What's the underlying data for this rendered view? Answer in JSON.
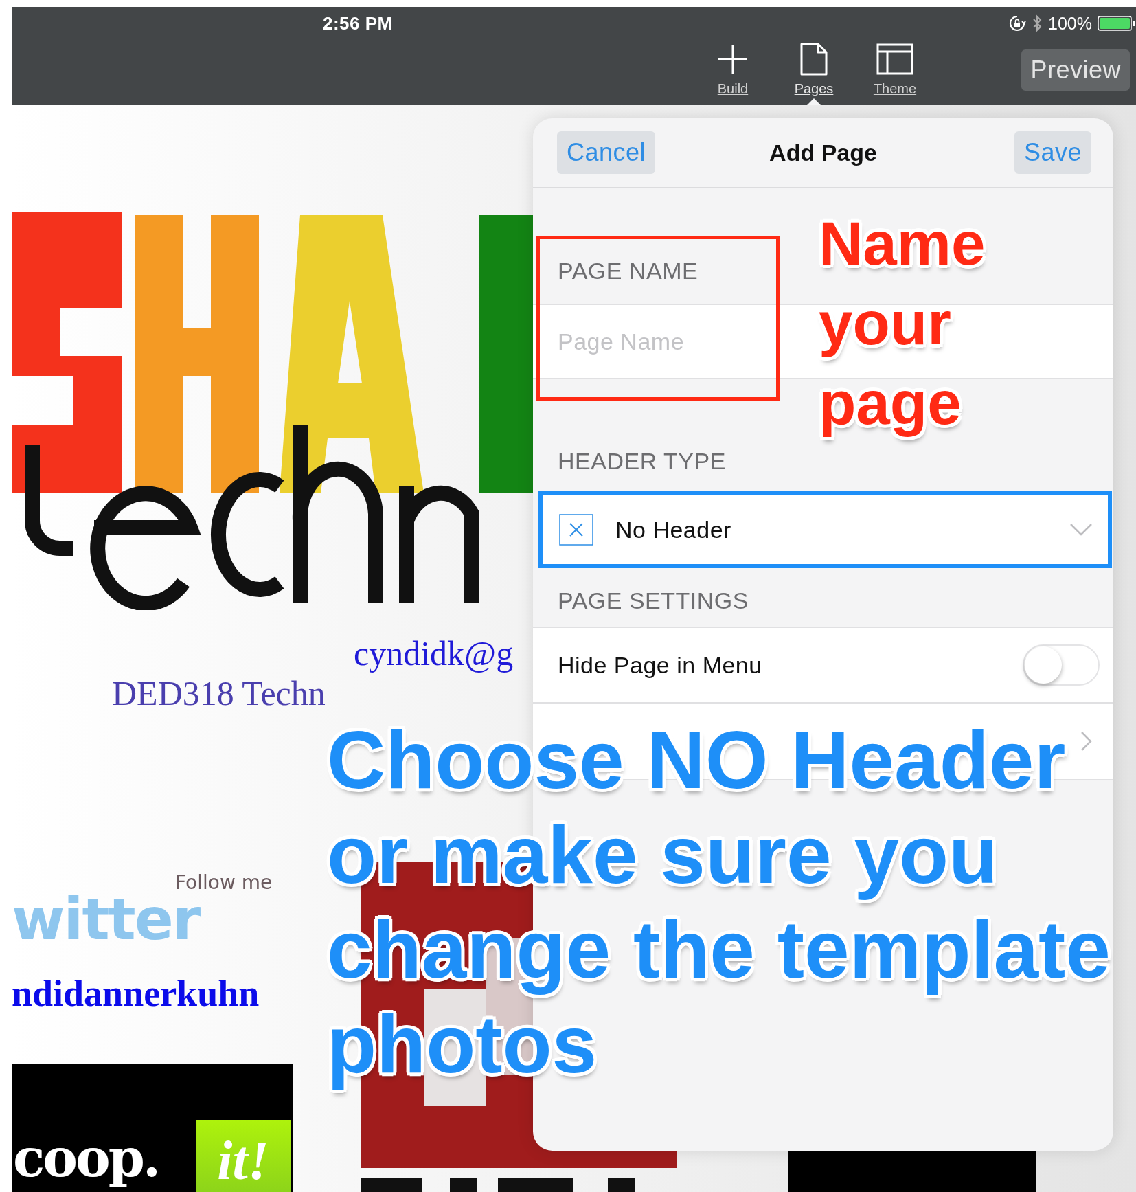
{
  "status_bar": {
    "time": "2:56 PM",
    "battery": "100%"
  },
  "toolbar": {
    "tabs": [
      {
        "label": "Build",
        "selected": false
      },
      {
        "label": "Pages",
        "selected": true
      },
      {
        "label": "Theme",
        "selected": false
      }
    ],
    "preview_button": "Preview"
  },
  "site": {
    "email": "cyndidk@g",
    "course_title": "DED318 Techn",
    "twitter_badge": {
      "caption": "Follow me",
      "wordmark": "witter"
    },
    "twitter_handle": "ndidannerkuhn",
    "scoopit_logo": {
      "word": "coop.",
      "accent": "it!"
    }
  },
  "panel": {
    "cancel": "Cancel",
    "title": "Add Page",
    "save": "Save",
    "page_name": {
      "label": "PAGE NAME",
      "placeholder": "Page Name",
      "highlighted": true
    },
    "header_type": {
      "label": "HEADER TYPE",
      "value": "No Header",
      "highlighted": true
    },
    "page_settings": {
      "label": "PAGE SETTINGS",
      "rows": [
        {
          "kind": "toggle",
          "label": "Hide Page in Menu",
          "on": false
        },
        {
          "kind": "link"
        }
      ]
    }
  },
  "callouts": [
    {
      "color": "#ff2a14",
      "lines": [
        "Name",
        "your",
        "page"
      ]
    },
    {
      "color": "#1e8ff8",
      "lines": [
        "Choose NO Header",
        "or make sure you",
        "change the template",
        "photos"
      ]
    }
  ]
}
